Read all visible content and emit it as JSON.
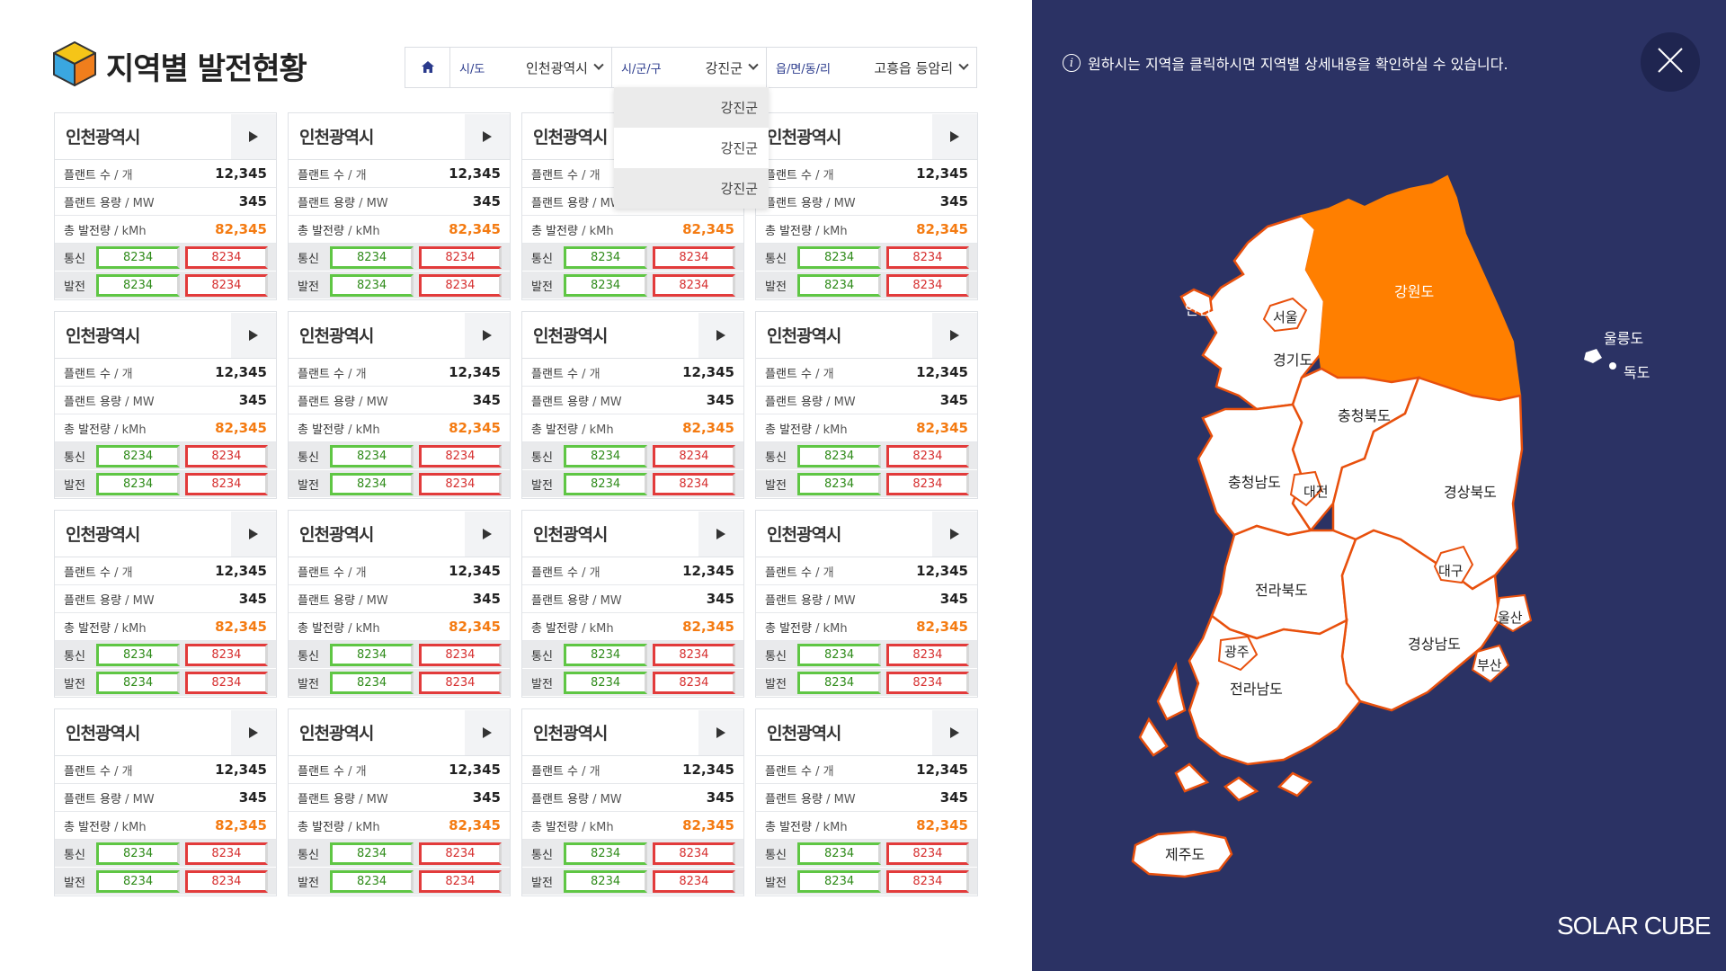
{
  "header": {
    "title": "지역별 발전현황"
  },
  "breadcrumb": {
    "sido_label": "시/도",
    "sido_value": "인천광역시",
    "sigungu_label": "시/군/구",
    "sigungu_value": "강진군",
    "eup_label": "읍/면/동/리",
    "eup_value": "고흥읍 등암리"
  },
  "dropdown": {
    "options": [
      "강진군",
      "강진군",
      "강진군"
    ]
  },
  "card_labels": {
    "plants": "플랜트 수",
    "plants_unit": " / 개",
    "capacity": "플랜트 용량",
    "capacity_unit": " / MW",
    "generation": "총 발전량",
    "generation_unit": " / kMh",
    "comm": "통신",
    "power": "발전"
  },
  "cards": [
    {
      "title": "인천광역시",
      "plants": "12,345",
      "capacity": "345",
      "generation": "82,345",
      "comm_ok": "8234",
      "comm_err": "8234",
      "power_ok": "8234",
      "power_err": "8234"
    },
    {
      "title": "인천광역시",
      "plants": "12,345",
      "capacity": "345",
      "generation": "82,345",
      "comm_ok": "8234",
      "comm_err": "8234",
      "power_ok": "8234",
      "power_err": "8234"
    },
    {
      "title": "인천광역시",
      "plants": "12,345",
      "capacity": "345",
      "generation": "82,345",
      "comm_ok": "8234",
      "comm_err": "8234",
      "power_ok": "8234",
      "power_err": "8234"
    },
    {
      "title": "인천광역시",
      "plants": "12,345",
      "capacity": "345",
      "generation": "82,345",
      "comm_ok": "8234",
      "comm_err": "8234",
      "power_ok": "8234",
      "power_err": "8234"
    },
    {
      "title": "인천광역시",
      "plants": "12,345",
      "capacity": "345",
      "generation": "82,345",
      "comm_ok": "8234",
      "comm_err": "8234",
      "power_ok": "8234",
      "power_err": "8234"
    },
    {
      "title": "인천광역시",
      "plants": "12,345",
      "capacity": "345",
      "generation": "82,345",
      "comm_ok": "8234",
      "comm_err": "8234",
      "power_ok": "8234",
      "power_err": "8234"
    },
    {
      "title": "인천광역시",
      "plants": "12,345",
      "capacity": "345",
      "generation": "82,345",
      "comm_ok": "8234",
      "comm_err": "8234",
      "power_ok": "8234",
      "power_err": "8234"
    },
    {
      "title": "인천광역시",
      "plants": "12,345",
      "capacity": "345",
      "generation": "82,345",
      "comm_ok": "8234",
      "comm_err": "8234",
      "power_ok": "8234",
      "power_err": "8234"
    },
    {
      "title": "인천광역시",
      "plants": "12,345",
      "capacity": "345",
      "generation": "82,345",
      "comm_ok": "8234",
      "comm_err": "8234",
      "power_ok": "8234",
      "power_err": "8234"
    },
    {
      "title": "인천광역시",
      "plants": "12,345",
      "capacity": "345",
      "generation": "82,345",
      "comm_ok": "8234",
      "comm_err": "8234",
      "power_ok": "8234",
      "power_err": "8234"
    },
    {
      "title": "인천광역시",
      "plants": "12,345",
      "capacity": "345",
      "generation": "82,345",
      "comm_ok": "8234",
      "comm_err": "8234",
      "power_ok": "8234",
      "power_err": "8234"
    },
    {
      "title": "인천광역시",
      "plants": "12,345",
      "capacity": "345",
      "generation": "82,345",
      "comm_ok": "8234",
      "comm_err": "8234",
      "power_ok": "8234",
      "power_err": "8234"
    },
    {
      "title": "인천광역시",
      "plants": "12,345",
      "capacity": "345",
      "generation": "82,345",
      "comm_ok": "8234",
      "comm_err": "8234",
      "power_ok": "8234",
      "power_err": "8234"
    },
    {
      "title": "인천광역시",
      "plants": "12,345",
      "capacity": "345",
      "generation": "82,345",
      "comm_ok": "8234",
      "comm_err": "8234",
      "power_ok": "8234",
      "power_err": "8234"
    },
    {
      "title": "인천광역시",
      "plants": "12,345",
      "capacity": "345",
      "generation": "82,345",
      "comm_ok": "8234",
      "comm_err": "8234",
      "power_ok": "8234",
      "power_err": "8234"
    },
    {
      "title": "인천광역시",
      "plants": "12,345",
      "capacity": "345",
      "generation": "82,345",
      "comm_ok": "8234",
      "comm_err": "8234",
      "power_ok": "8234",
      "power_err": "8234"
    }
  ],
  "map_panel": {
    "info_text": "원하시는 지역을 클릭하시면 지역별 상세내용을 확인하실 수 있습니다.",
    "info_icon": "info-icon",
    "close_icon": "close-icon",
    "brand": "SOLAR CUBE",
    "regions": {
      "incheon": "인천",
      "seoul": "서울",
      "gyeonggi": "경기도",
      "gangwon": "강원도",
      "ulleung": "울릉도",
      "dokdo": "독도",
      "chungbuk": "충청북도",
      "chungnam": "충청남도",
      "daejeon": "대전",
      "gyeongbuk": "경상북도",
      "daegu": "대구",
      "jeonbuk": "전라북도",
      "ulsan": "울산",
      "gwangju": "광주",
      "gyeongnam": "경상남도",
      "busan": "부산",
      "jeonnam": "전라남도",
      "jeju": "제주도"
    },
    "selected_region": "강원도"
  },
  "colors": {
    "panel_bg": "#2b3264",
    "highlight": "#ff7f00",
    "ok_green": "#5fc644",
    "error_red": "#e23b3b",
    "accent_orange": "#f47b12"
  }
}
